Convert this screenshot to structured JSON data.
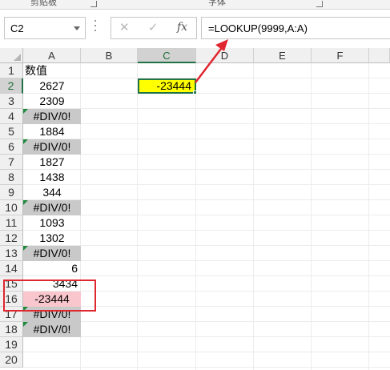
{
  "ribbon": {
    "group_left": "剪贴板",
    "group_mid": "字体"
  },
  "name_box": {
    "value": "C2"
  },
  "formula_bar": {
    "cancel_glyph": "✕",
    "enter_glyph": "✓",
    "fx_label": "fx",
    "formula": "=LOOKUP(9999,A:A)"
  },
  "columns": [
    "A",
    "B",
    "C",
    "D",
    "E",
    "F"
  ],
  "selected_column": "C",
  "rows": [
    "1",
    "2",
    "3",
    "4",
    "5",
    "6",
    "7",
    "8",
    "9",
    "10",
    "11",
    "12",
    "13",
    "14",
    "15",
    "16",
    "17",
    "18",
    "19",
    "20"
  ],
  "selected_row": "2",
  "column_a": [
    {
      "row": 1,
      "value": "数值",
      "type": "header"
    },
    {
      "row": 2,
      "value": "2627",
      "type": "num"
    },
    {
      "row": 3,
      "value": "2309",
      "type": "num"
    },
    {
      "row": 4,
      "value": "#DIV/0!",
      "type": "err"
    },
    {
      "row": 5,
      "value": "1884",
      "type": "num"
    },
    {
      "row": 6,
      "value": "#DIV/0!",
      "type": "err"
    },
    {
      "row": 7,
      "value": "1827",
      "type": "num"
    },
    {
      "row": 8,
      "value": "1438",
      "type": "num"
    },
    {
      "row": 9,
      "value": "344",
      "type": "num"
    },
    {
      "row": 10,
      "value": "#DIV/0!",
      "type": "err"
    },
    {
      "row": 11,
      "value": "1093",
      "type": "num"
    },
    {
      "row": 12,
      "value": "1302",
      "type": "num"
    },
    {
      "row": 13,
      "value": "#DIV/0!",
      "type": "err"
    },
    {
      "row": 14,
      "value": "6",
      "type": "right"
    },
    {
      "row": 15,
      "value": "3434",
      "type": "right"
    },
    {
      "row": 16,
      "value": "-23444",
      "type": "pink"
    },
    {
      "row": 17,
      "value": "#DIV/0!",
      "type": "err"
    },
    {
      "row": 18,
      "value": "#DIV/0!",
      "type": "err"
    }
  ],
  "active_cell": {
    "ref": "C2",
    "value": "-23444",
    "fill": "#ffff00"
  },
  "colors": {
    "selection_green": "#217346",
    "highlight_red": "#e0262f",
    "error_gray": "#c9c9c9",
    "pink_fill": "#f8c6cc"
  }
}
